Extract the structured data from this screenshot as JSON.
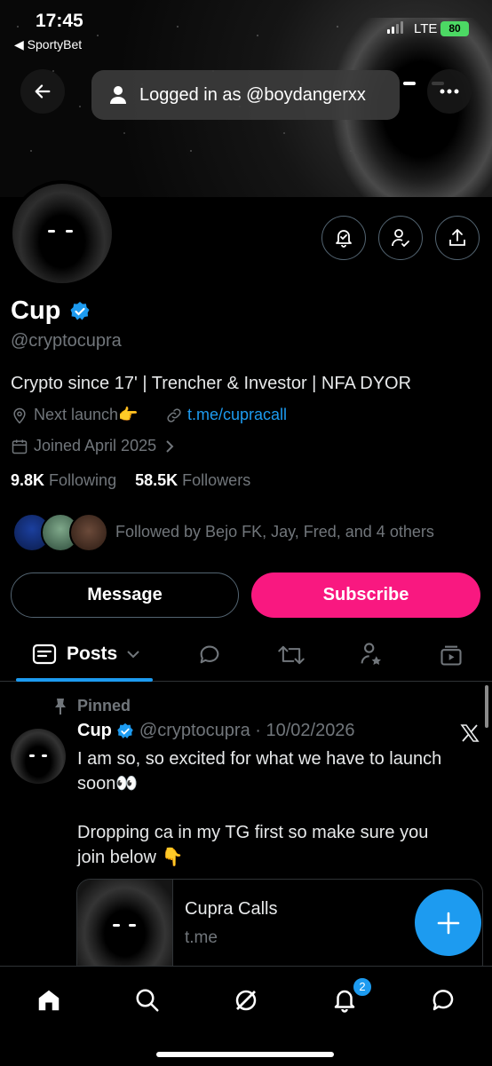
{
  "status_bar": {
    "time": "17:45",
    "back_app": "◀ SportyBet",
    "network": "LTE",
    "battery": "80"
  },
  "header": {
    "logged_in_text": "Logged in as @boydangerxx"
  },
  "profile": {
    "name": "Cup",
    "handle": "@cryptocupra",
    "bio": "Crypto since 17' | Trencher & Investor | NFA DYOR",
    "location": "Next launch👉",
    "link": "t.me/cupracall",
    "joined": "Joined April 2025",
    "following_count": "9.8K",
    "following_label": "Following",
    "followers_count": "58.5K",
    "followers_label": "Followers",
    "followed_by": "Followed by Bejo FK, Jay, Fred, and 4 others"
  },
  "buttons": {
    "message": "Message",
    "subscribe": "Subscribe"
  },
  "tabs": {
    "posts": "Posts"
  },
  "post": {
    "pinned": "Pinned",
    "name": "Cup",
    "handle_date": "@cryptocupra · 10/02/2026",
    "line1": "I am so, so excited for what we have to launch",
    "line2": "soon👀",
    "line3": "Dropping ca in my TG first so make sure you",
    "line4": "join below 👇",
    "card_title": "Cupra Calls",
    "card_domain": "t.me"
  },
  "nav": {
    "notifications_badge": "2"
  },
  "colors": {
    "accent": "#1d9bf0",
    "subscribe": "#f91880",
    "muted": "#71767b"
  }
}
